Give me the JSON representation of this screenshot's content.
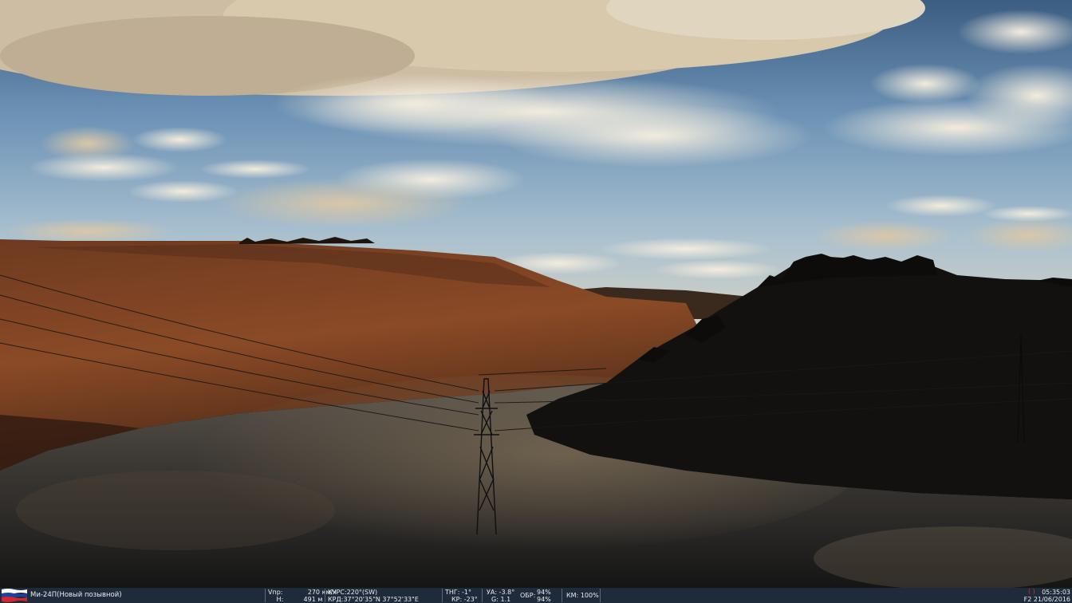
{
  "hud": {
    "unit_name": "Ми-24П(Новый позывной)",
    "vpr_label": "Vпр:",
    "vpr_value": "270",
    "vpr_unit": "км/ч",
    "h_label": "Н:",
    "h_value": "491",
    "h_unit": "м",
    "kurs": "КУРС:220°(SW)",
    "krd": "КРД:37°20'35\"N 37°52'33\"E",
    "tng": "ТНГ: -1°",
    "kr": "КР: -23°",
    "ua": "УА: -3.8°",
    "g": "G: 1.1",
    "obr_label": "ОБР:",
    "obr_1": "94%",
    "obr_2": "94%",
    "km": "КМ: 100%",
    "time": "05:35:03",
    "date": "F2 21/06/2016",
    "colors": {
      "hud_bg": "#1f2a3a",
      "hud_text": "#e9edf2",
      "flag_white": "#ffffff",
      "flag_blue": "#1c3fa8",
      "flag_red": "#d5262b"
    }
  }
}
